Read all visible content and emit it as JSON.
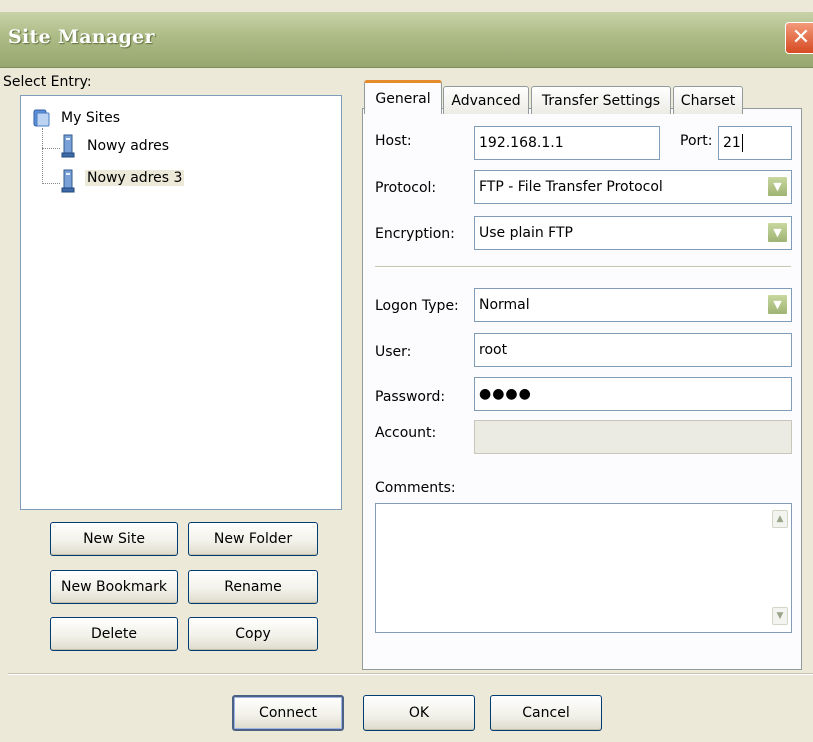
{
  "window": {
    "title": "Site Manager",
    "close_glyph": "✕"
  },
  "left": {
    "select_label": "Select Entry:",
    "tree": {
      "root": "My Sites",
      "items": [
        {
          "label": "Nowy adres",
          "selected": false
        },
        {
          "label": "Nowy adres 3",
          "selected": true
        }
      ]
    },
    "buttons": {
      "new_site": "New Site",
      "new_folder": "New Folder",
      "new_bookmark": "New Bookmark",
      "rename": "Rename",
      "delete": "Delete",
      "copy": "Copy"
    }
  },
  "tabs": [
    "General",
    "Advanced",
    "Transfer Settings",
    "Charset"
  ],
  "general": {
    "host_label": "Host:",
    "host_value": "192.168.1.1",
    "port_label": "Port:",
    "port_value": "21",
    "protocol_label": "Protocol:",
    "protocol_value": "FTP - File Transfer Protocol",
    "encryption_label": "Encryption:",
    "encryption_value": "Use plain FTP",
    "logon_label": "Logon Type:",
    "logon_value": "Normal",
    "user_label": "User:",
    "user_value": "root",
    "password_label": "Password:",
    "password_value": "●●●●",
    "account_label": "Account:",
    "account_value": "",
    "comments_label": "Comments:",
    "comments_value": ""
  },
  "footer": {
    "connect": "Connect",
    "ok": "OK",
    "cancel": "Cancel"
  },
  "icons": {
    "dropdown": "chevron-down-icon",
    "folder": "folder-icon",
    "server": "server-icon"
  },
  "colors": {
    "tab_accent": "#e68b2c",
    "title_bar": "#adbb86",
    "window_bg": "#ece9d8"
  }
}
